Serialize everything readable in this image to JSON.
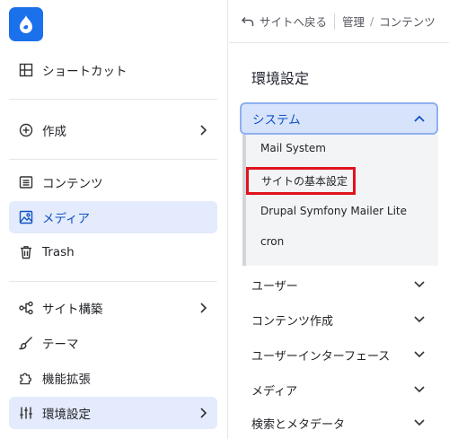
{
  "sidebar": {
    "logo_icon": "drupal-drop-icon",
    "items": [
      {
        "label": "ショートカット",
        "icon": "shortcut-grid-icon"
      },
      {
        "label": "作成",
        "icon": "plus-circle-icon"
      },
      {
        "label": "コンテンツ",
        "icon": "document-list-icon"
      },
      {
        "label": "メディア",
        "icon": "image-icon"
      },
      {
        "label": "Trash",
        "icon": "trash-icon"
      },
      {
        "label": "サイト構築",
        "icon": "structure-icon"
      },
      {
        "label": "テーマ",
        "icon": "brush-icon"
      },
      {
        "label": "機能拡張",
        "icon": "puzzle-icon"
      },
      {
        "label": "環境設定",
        "icon": "sliders-icon"
      }
    ]
  },
  "topbar": {
    "back_label": "サイトへ戻る",
    "breadcrumb": [
      "管理",
      "コンテンツ"
    ]
  },
  "panel": {
    "title": "環境設定",
    "open_section": "システム",
    "submenu": [
      "Mail System",
      "サイトの基本設定",
      "Drupal Symfony Mailer Lite",
      "cron"
    ],
    "sections": [
      "ユーザー",
      "コンテンツ作成",
      "ユーザーインターフェース",
      "メディア",
      "検索とメタデータ"
    ]
  },
  "colors": {
    "accent": "#1b70ec",
    "active_bg": "#e3ebfc",
    "active_text": "#0f52c4",
    "highlight_box": "#e0131d"
  }
}
